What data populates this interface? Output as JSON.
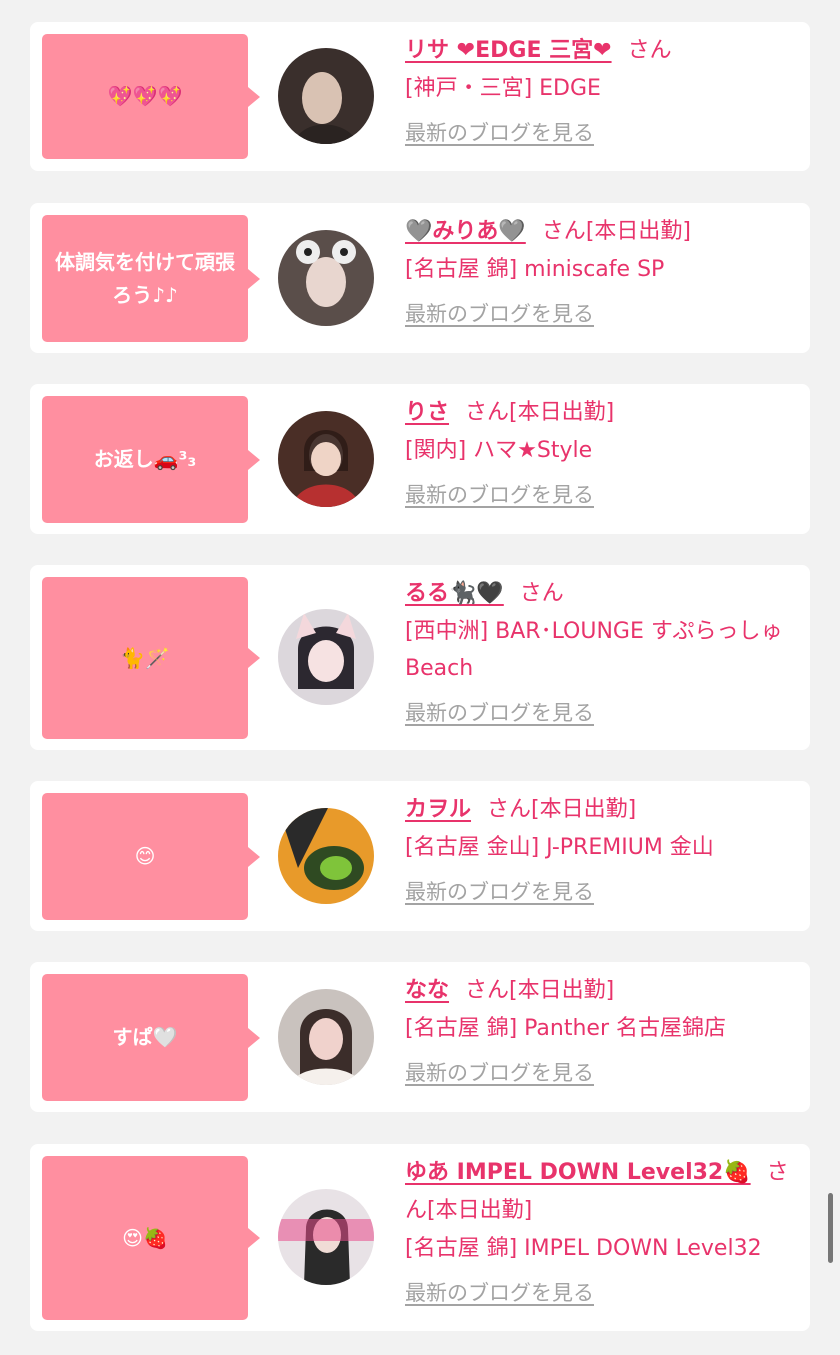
{
  "cards": [
    {
      "bubble": "💖💖💖",
      "name": "リサ ❤EDGE 三宮❤",
      "suffix": "さん",
      "status": "",
      "shop": "[神戸・三宮] EDGE",
      "blog_link": "最新のブログを見る",
      "avatar_colors": [
        "#3a2f2c",
        "#d9c2b3"
      ]
    },
    {
      "bubble": "体調気を付けて頑張ろう♪♪",
      "name": "🩶みりあ🩶",
      "suffix": "さん",
      "status": "[本日出勤]",
      "shop": "[名古屋 錦] miniscafe SP",
      "blog_link": "最新のブログを見る",
      "avatar_colors": [
        "#5a4e4a",
        "#eeeeee"
      ]
    },
    {
      "bubble": "お返し🚗³₃",
      "name": "りさ",
      "suffix": "さん",
      "status": "[本日出勤]",
      "shop": "[関内] ハマ★Style",
      "blog_link": "最新のブログを見る",
      "avatar_colors": [
        "#4a2e26",
        "#b73030"
      ]
    },
    {
      "bubble": "🐈🪄",
      "name": "るる🐈‍⬛🖤",
      "suffix": "さん",
      "status": "",
      "shop": "[西中洲] BAR･LOUNGE すぷらっしゅBeach",
      "blog_link": "最新のブログを見る",
      "avatar_colors": [
        "#2c2830",
        "#f4d8dc"
      ]
    },
    {
      "bubble": "😊",
      "name": "カヲル",
      "suffix": "さん",
      "status": "[本日出勤]",
      "shop": "[名古屋 金山] J-PREMIUM 金山",
      "blog_link": "最新のブログを見る",
      "avatar_colors": [
        "#2f4a22",
        "#e89a2a"
      ]
    },
    {
      "bubble": "すぱ🤍",
      "name": "なな",
      "suffix": "さん",
      "status": "[本日出勤]",
      "shop": "[名古屋 錦] Panther 名古屋錦店",
      "blog_link": "最新のブログを見る",
      "avatar_colors": [
        "#3b2d2a",
        "#f0d2cc"
      ]
    },
    {
      "bubble": "😍🍓",
      "name": "ゆあ IMPEL DOWN Level32🍓",
      "suffix": "さん",
      "status": "[本日出勤]",
      "shop": "[名古屋 錦] IMPEL DOWN Level32",
      "blog_link": "最新のブログを見る",
      "avatar_colors": [
        "#2a2a2a",
        "#e84a8a"
      ]
    }
  ],
  "colors": {
    "accent": "#e8336b",
    "bubble_bg": "#ff8fa0",
    "link_gray": "#a3a3a3",
    "page_bg": "#f2f2f2"
  }
}
